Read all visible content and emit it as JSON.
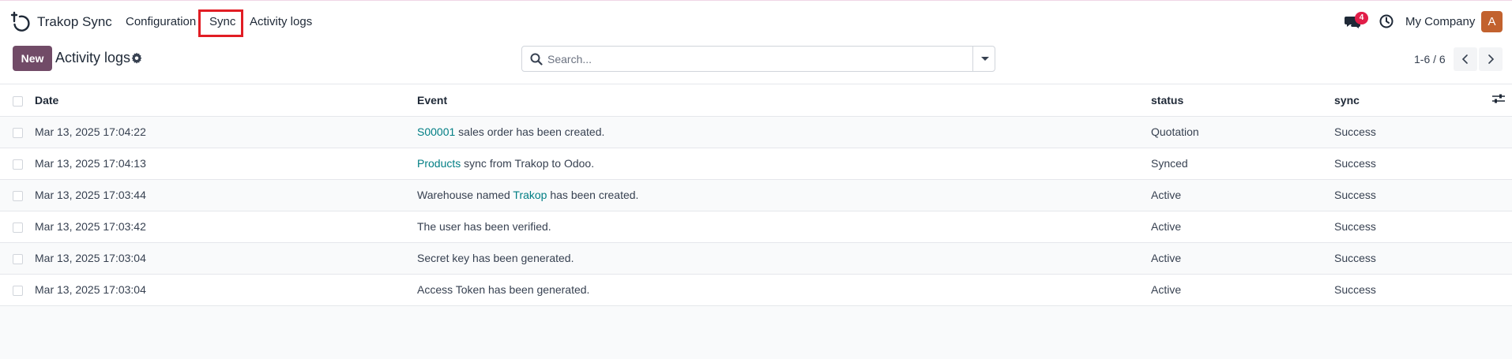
{
  "app": {
    "name": "Trakop Sync"
  },
  "menu": {
    "configuration": "Configuration",
    "sync": "Sync",
    "activity_logs": "Activity logs"
  },
  "systray": {
    "messages_count": "4",
    "company": "My Company",
    "avatar_initial": "A"
  },
  "control": {
    "new_label": "New",
    "page_title": "Activity logs",
    "search_placeholder": "Search...",
    "pager": "1-6 / 6"
  },
  "table": {
    "headers": {
      "date": "Date",
      "event": "Event",
      "status": "status",
      "sync": "sync"
    },
    "rows": [
      {
        "date": "Mar 13, 2025 17:04:22",
        "event_prefix": "",
        "event_link": "S00001",
        "event_suffix": " sales order has been created.",
        "status": "Quotation",
        "sync": "Success"
      },
      {
        "date": "Mar 13, 2025 17:04:13",
        "event_prefix": "",
        "event_link": "Products",
        "event_suffix": " sync from Trakop to Odoo.",
        "status": "Synced",
        "sync": "Success"
      },
      {
        "date": "Mar 13, 2025 17:03:44",
        "event_prefix": "Warehouse named ",
        "event_link": "Trakop",
        "event_suffix": " has been created.",
        "status": "Active",
        "sync": "Success"
      },
      {
        "date": "Mar 13, 2025 17:03:42",
        "event_prefix": "The user has been verified.",
        "event_link": "",
        "event_suffix": "",
        "status": "Active",
        "sync": "Success"
      },
      {
        "date": "Mar 13, 2025 17:03:04",
        "event_prefix": "Secret key has been generated.",
        "event_link": "",
        "event_suffix": "",
        "status": "Active",
        "sync": "Success"
      },
      {
        "date": "Mar 13, 2025 17:03:04",
        "event_prefix": "Access Token has been generated.",
        "event_link": "",
        "event_suffix": "",
        "status": "Active",
        "sync": "Success"
      }
    ]
  },
  "colors": {
    "brand": "#714b67",
    "link": "#017e84",
    "badge": "#e11d48",
    "avatar": "#c2622e",
    "highlight": "#e11d24"
  },
  "icons": [
    "trakop-logo-icon",
    "chat-icon",
    "clock-icon",
    "gear-icon",
    "search-icon",
    "chevron-down-icon",
    "chevron-left-icon",
    "chevron-right-icon",
    "column-options-icon"
  ]
}
